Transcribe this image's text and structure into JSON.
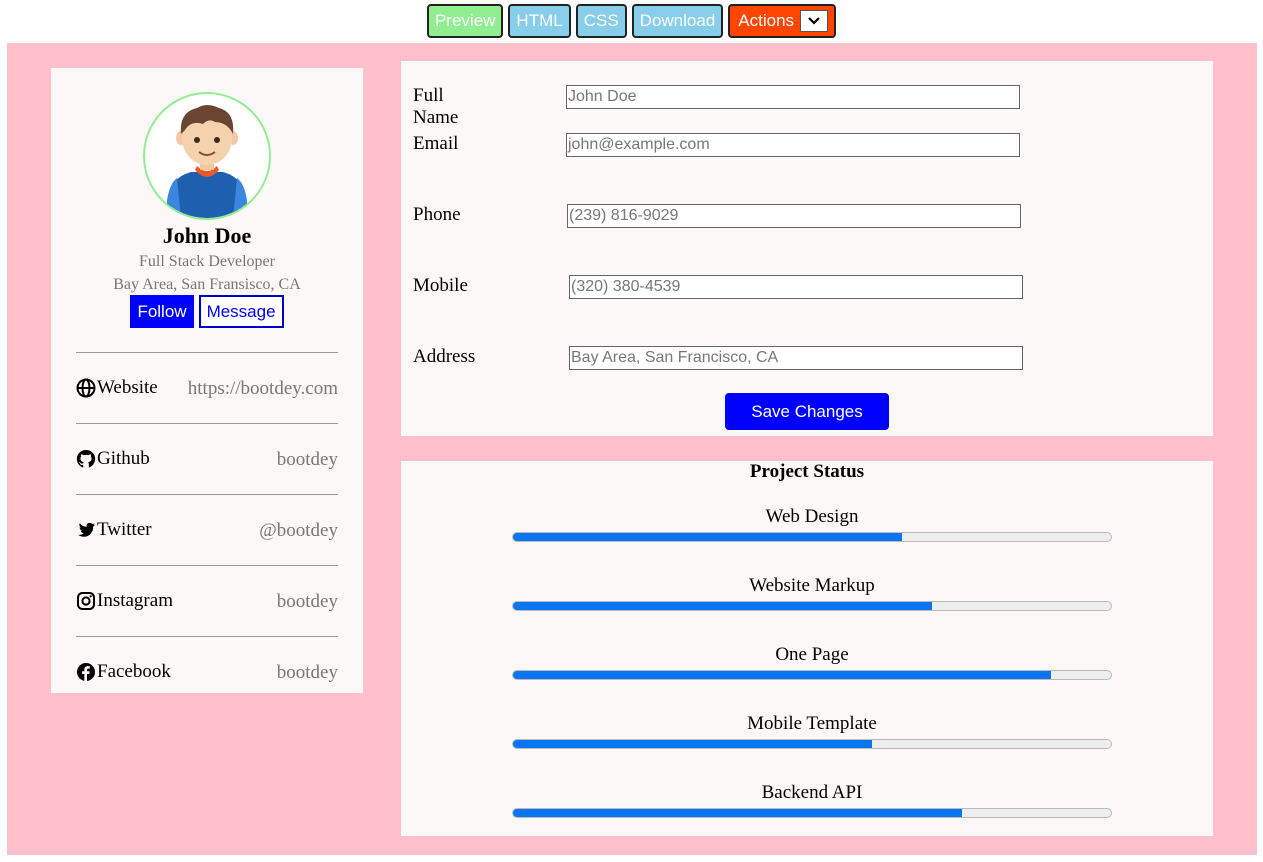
{
  "toolbar": {
    "preview": "Preview",
    "html": "HTML",
    "css": "CSS",
    "download": "Download",
    "actions": "Actions",
    "actions_dropdown_icon": "chevron-down-icon"
  },
  "profile": {
    "name": "John Doe",
    "role": "Full Stack Developer",
    "location": "Bay Area, San Fransisco, CA",
    "follow_label": "Follow",
    "message_label": "Message",
    "social": [
      {
        "label": "Website",
        "value": "https://bootdey.com",
        "icon": "globe-icon"
      },
      {
        "label": "Github",
        "value": "bootdey",
        "icon": "github-icon"
      },
      {
        "label": "Twitter",
        "value": "@bootdey",
        "icon": "twitter-icon"
      },
      {
        "label": "Instagram",
        "value": "bootdey",
        "icon": "instagram-icon"
      },
      {
        "label": "Facebook",
        "value": "bootdey",
        "icon": "facebook-icon"
      }
    ]
  },
  "form": {
    "fields": [
      {
        "label": "Full Name",
        "value": "John Doe"
      },
      {
        "label": "Email",
        "value": "john@example.com"
      },
      {
        "label": "Phone",
        "value": "(239) 816-9029"
      },
      {
        "label": "Mobile",
        "value": "(320) 380-4539"
      },
      {
        "label": "Address",
        "value": "Bay Area, San Francisco, CA"
      }
    ],
    "save_label": "Save Changes"
  },
  "project_status": {
    "title": "Project Status",
    "items": [
      {
        "label": "Web Design",
        "progress": 65
      },
      {
        "label": "Website Markup",
        "progress": 70
      },
      {
        "label": "One Page",
        "progress": 90
      },
      {
        "label": "Mobile Template",
        "progress": 60
      },
      {
        "label": "Backend API",
        "progress": 75
      }
    ]
  },
  "colors": {
    "background": "#ffc0cb",
    "card": "#fcf8f7",
    "accent": "#0000ff",
    "progress": "#0a75f0",
    "actions": "#ff4500",
    "preview": "#90ee90",
    "tab": "#87ceeb"
  }
}
